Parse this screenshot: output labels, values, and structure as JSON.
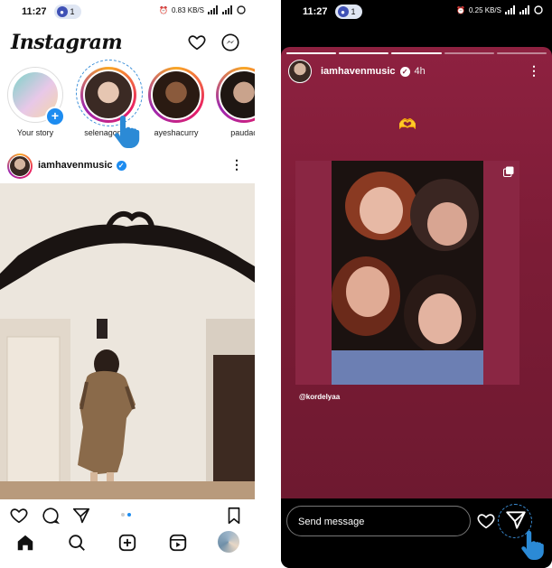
{
  "left_screen": {
    "status": {
      "time": "11:27",
      "notif_count": "1",
      "speed": "0.83 KB/S"
    },
    "header": {
      "logo": "Instagram",
      "icons": [
        "heart-icon",
        "messenger-icon"
      ]
    },
    "stories": [
      {
        "label": "Your story",
        "has_plus": true
      },
      {
        "label": "selenagomez",
        "has_plus": false
      },
      {
        "label": "ayeshacurry",
        "has_plus": false
      },
      {
        "label": "paudac",
        "has_plus": false
      }
    ],
    "post": {
      "username": "iamhavenmusic",
      "verified": true,
      "carousel_total": 2,
      "carousel_index": 2
    },
    "actions": [
      "heart-icon",
      "comment-icon",
      "share-icon",
      "bookmark-icon"
    ],
    "nav": [
      "home-icon",
      "search-icon",
      "create-icon",
      "reels-icon",
      "profile-avatar"
    ]
  },
  "right_screen": {
    "status": {
      "time": "11:27",
      "notif_count": "1",
      "speed": "0.25 KB/S"
    },
    "story": {
      "username": "iamhavenmusic",
      "verified": true,
      "age": "4h",
      "mention": "@kordelyaa",
      "emoji": "🫶",
      "progress_segments": 5,
      "progress_done": 3
    },
    "reply": {
      "placeholder": "Send message"
    }
  },
  "colors": {
    "accent": "#1d8cf0",
    "story_bg": "#7c1c36",
    "highlight": "#3b8fd8"
  }
}
